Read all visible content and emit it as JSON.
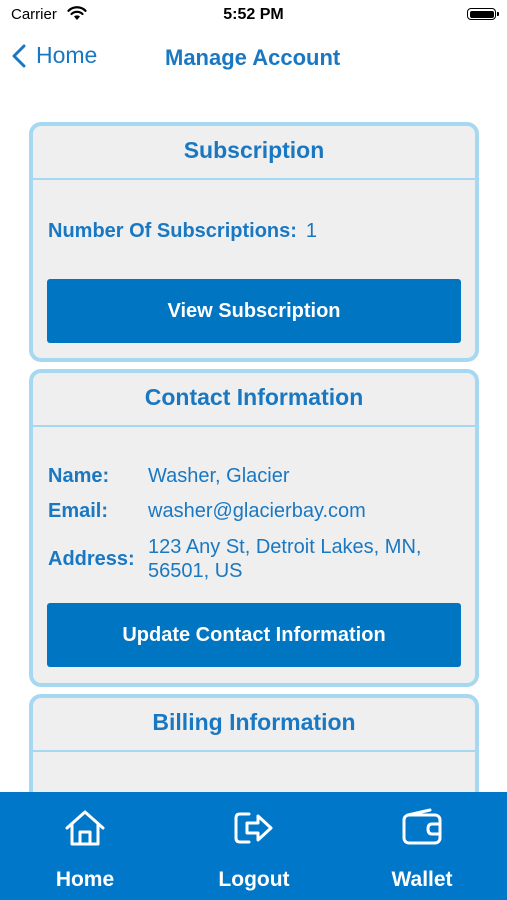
{
  "status_bar": {
    "carrier": "Carrier",
    "time": "5:52 PM"
  },
  "nav": {
    "back_label": "Home",
    "title": "Manage Account"
  },
  "subscription": {
    "header": "Subscription",
    "count_label": "Number Of Subscriptions:",
    "count_value": "1",
    "button_label": "View Subscription"
  },
  "contact": {
    "header": "Contact Information",
    "name_label": "Name:",
    "name_value": "Washer, Glacier",
    "email_label": "Email:",
    "email_value": "washer@glacierbay.com",
    "address_label": "Address:",
    "address_line1": "123 Any St, Detroit Lakes, MN,",
    "address_line2": "56501, US",
    "button_label": "Update Contact Information"
  },
  "billing": {
    "header": "Billing Information"
  },
  "tabbar": {
    "items": [
      {
        "label": "Home",
        "icon": "home-icon"
      },
      {
        "label": "Logout",
        "icon": "logout-icon"
      },
      {
        "label": "Wallet",
        "icon": "wallet-icon"
      }
    ]
  },
  "colors": {
    "accent": "#1a78c2",
    "button": "#0075c2",
    "card_border": "#a6d8f2",
    "card_bg": "#efefef",
    "tabbar": "#0077c8"
  }
}
